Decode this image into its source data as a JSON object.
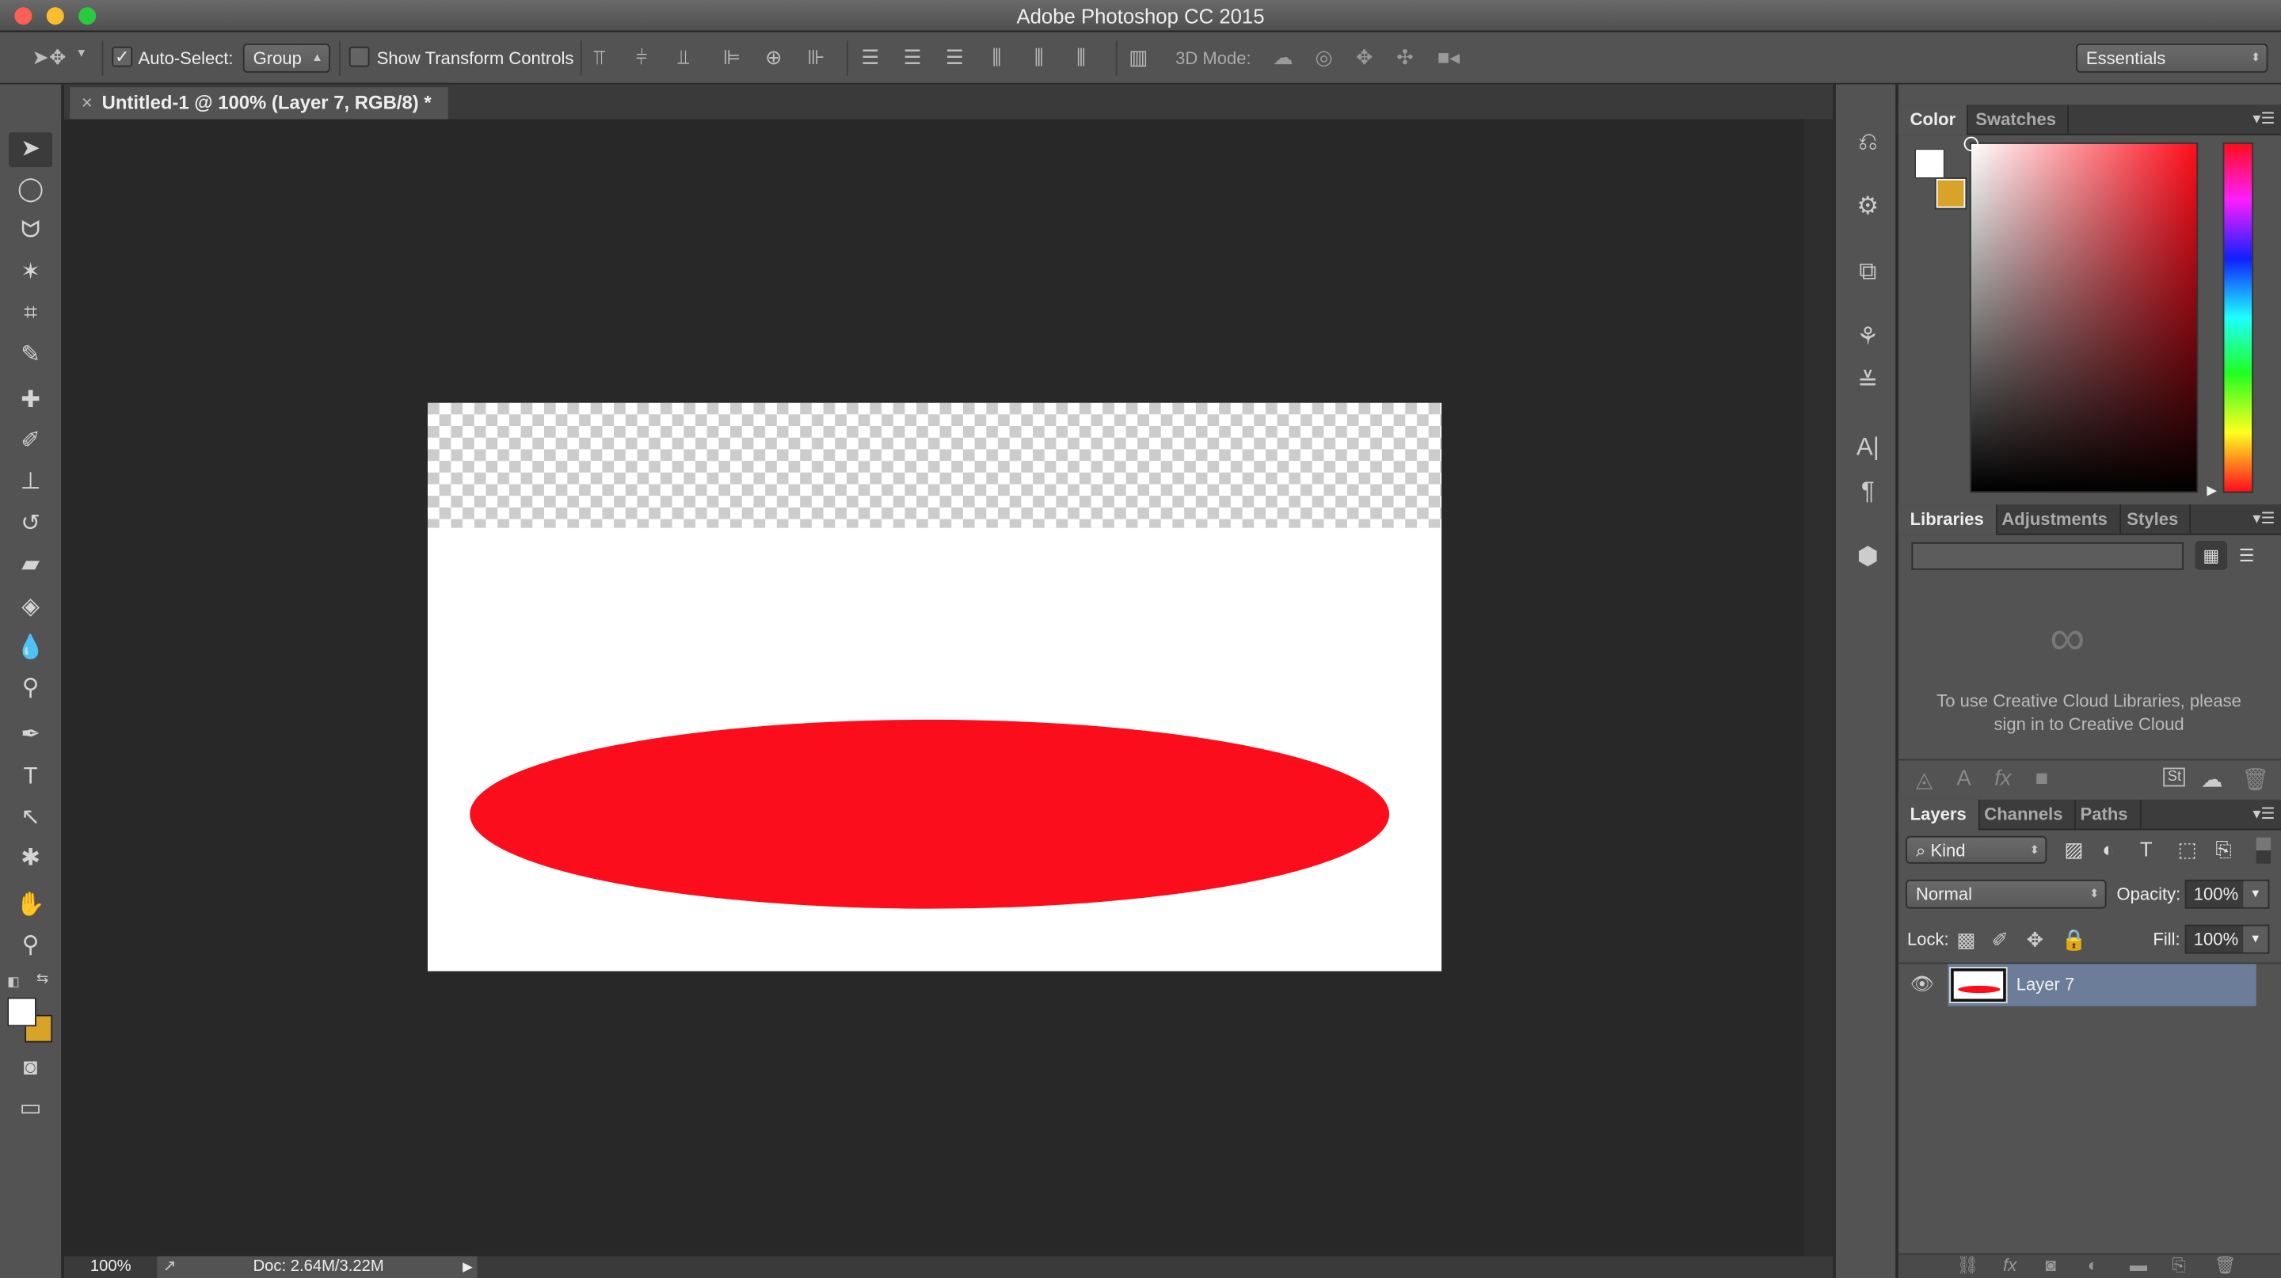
{
  "window": {
    "title": "Adobe Photoshop CC 2015"
  },
  "options_bar": {
    "auto_select_label": "Auto-Select:",
    "auto_select_checked": true,
    "auto_select_mode": "Group",
    "show_transform_label": "Show Transform Controls",
    "show_transform_checked": false,
    "mode_3d_label": "3D Mode:",
    "workspace": "Essentials"
  },
  "document": {
    "tab_title": "Untitled-1 @ 100% (Layer 7, RGB/8) *",
    "close_glyph": "×",
    "shape_color": "#fc0d1b",
    "transparent_top_fraction": 0.22
  },
  "status_bar": {
    "zoom": "100%",
    "doc_info": "Doc: 2.64M/3.22M"
  },
  "colors": {
    "foreground": "#ffffff",
    "background": "#d9a32a"
  },
  "color_panel": {
    "tabs": [
      "Color",
      "Swatches"
    ],
    "active": "Color"
  },
  "libraries_panel": {
    "tabs": [
      "Libraries",
      "Adjustments",
      "Styles"
    ],
    "active": "Libraries",
    "message": "To use Creative Cloud Libraries, please sign in to Creative Cloud"
  },
  "layers_panel": {
    "tabs": [
      "Layers",
      "Channels",
      "Paths"
    ],
    "active": "Layers",
    "filter_kind": "Kind",
    "blend_mode": "Normal",
    "opacity_label": "Opacity:",
    "opacity": "100%",
    "lock_label": "Lock:",
    "fill_label": "Fill:",
    "fill": "100%",
    "layers": [
      {
        "name": "Layer 7",
        "visible": true,
        "selected": true
      }
    ]
  }
}
